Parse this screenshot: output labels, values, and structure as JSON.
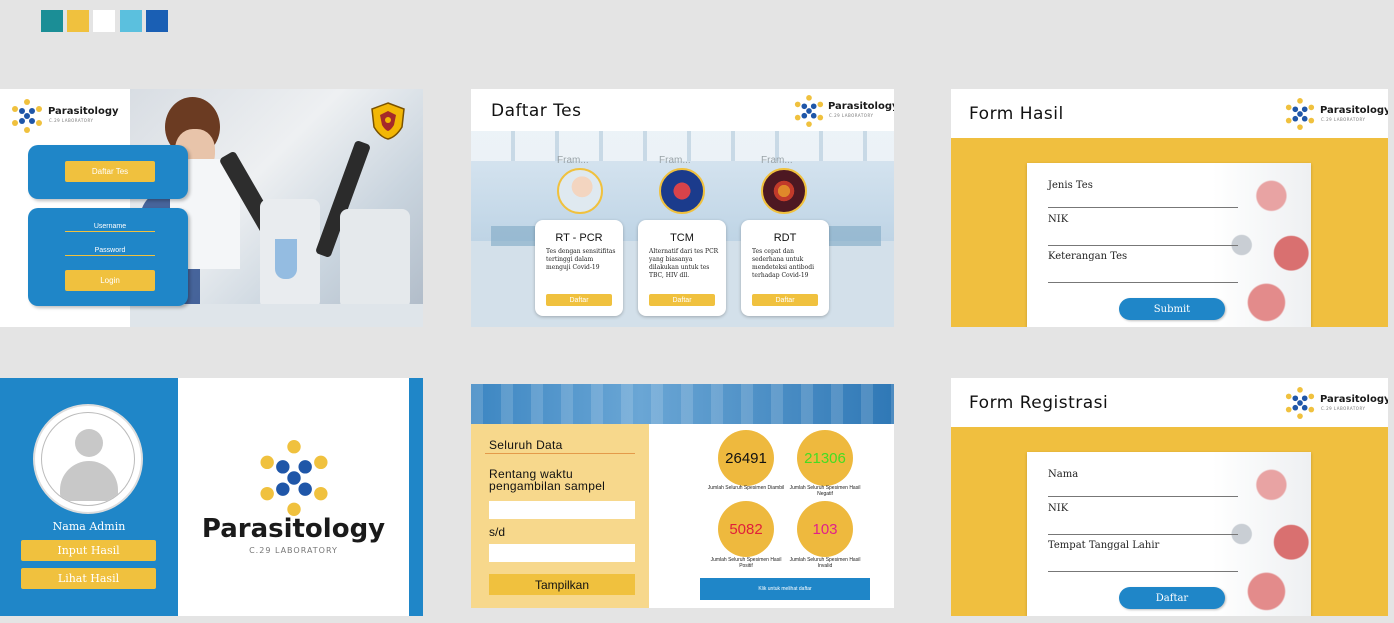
{
  "palette": [
    "#1b8e96",
    "#f0c13e",
    "#ffffff",
    "#5bc0de",
    "#1a5fb4"
  ],
  "brand": {
    "name": "Parasitology",
    "subtitle": "C.29 LABORATORY"
  },
  "login_screen": {
    "daftar_tes_button": "Daftar Tes",
    "username_label": "Username",
    "password_label": "Password",
    "login_button": "Login"
  },
  "daftar_tes_screen": {
    "title": "Daftar Tes",
    "frame_labels": [
      "Fram...",
      "Fram...",
      "Fram..."
    ],
    "tests": [
      {
        "name": "RT - PCR",
        "description": "Tes dengan sensitifitas tertinggi dalam menguji Covid-19",
        "button": "Daftar"
      },
      {
        "name": "TCM",
        "description": "Alternatif dari tes PCR yang biasanya dilakukan untuk tes TBC, HIV dll.",
        "button": "Daftar"
      },
      {
        "name": "RDT",
        "description": "Tes cepat dan sederhana untuk mendeteksi antibodi terhadap Covid-19",
        "button": "Daftar"
      }
    ]
  },
  "form_hasil": {
    "title": "Form Hasil",
    "fields": [
      "Jenis Tes",
      "NIK",
      "Keterangan Tes"
    ],
    "submit": "Submit"
  },
  "admin_screen": {
    "name": "Nama Admin",
    "input_button": "Input Hasil",
    "view_button": "Lihat Hasil"
  },
  "dashboard": {
    "seluruh_data": "Seluruh Data",
    "range_label": "Rentang waktu pengambilan sampel",
    "sd_label": "s/d",
    "show_button": "Tampilkan",
    "stats": [
      {
        "value": "26491",
        "caption": "Jumlah Seluruh Spesimen Diambil",
        "color": "#111111"
      },
      {
        "value": "21306",
        "caption": "Jumlah Seluruh Spesimen Hasil Negatif",
        "color": "#44dd22"
      },
      {
        "value": "5082",
        "caption": "Jumlah Seluruh Spesimen Hasil Positif",
        "color": "#e0203a"
      },
      {
        "value": "103",
        "caption": "Jumlah Seluruh Spesimen Hasil Invalid",
        "color": "#e0208a"
      }
    ],
    "list_button": "Klik untuk melihat daftar"
  },
  "form_registrasi": {
    "title": "Form Registrasi",
    "fields": [
      "Nama",
      "NIK",
      "Tempat Tanggal Lahir"
    ],
    "submit": "Daftar"
  }
}
